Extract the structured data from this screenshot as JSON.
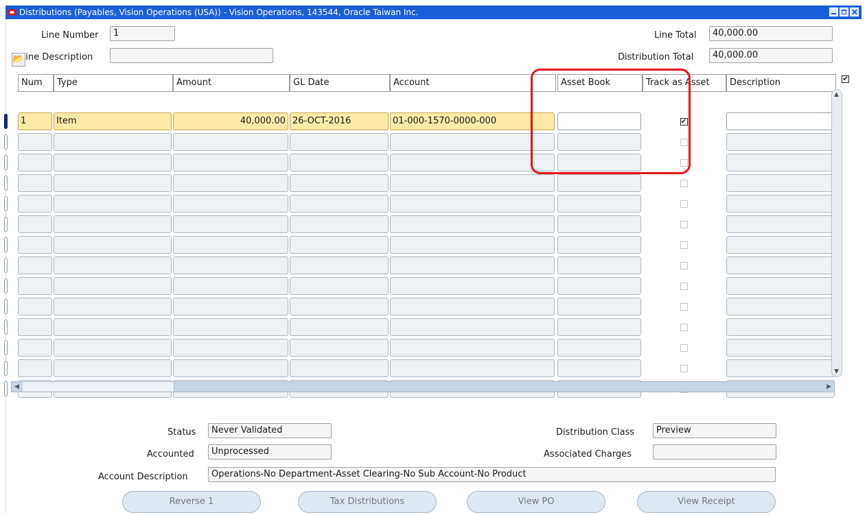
{
  "window": {
    "title": "Distributions (Payables, Vision Operations (USA)) - Vision Operations, 143544, Oracle Taiwan Inc."
  },
  "header": {
    "line_number_label": "Line Number",
    "line_number_value": "1",
    "line_description_label": "Line Description",
    "line_description_value": "",
    "line_total_label": "Line Total",
    "line_total_value": "40,000.00",
    "distribution_total_label": "Distribution Total",
    "distribution_total_value": "40,000.00",
    "select_all_checked": true
  },
  "table": {
    "columns": [
      "Num",
      "Type",
      "Amount",
      "GL Date",
      "Account",
      "Asset Book",
      "Track as Asset",
      "Description"
    ],
    "rows": [
      {
        "num": "1",
        "type": "Item",
        "amount": "40,000.00",
        "gl_date": "26-OCT-2016",
        "account": "01-000-1570-0000-000",
        "asset_book": "",
        "track_as_asset": true,
        "description": ""
      }
    ],
    "empty_rows": 13
  },
  "footer": {
    "status_label": "Status",
    "status_value": "Never Validated",
    "accounted_label": "Accounted",
    "accounted_value": "Unprocessed",
    "account_description_label": "Account Description",
    "account_description_value": "Operations-No Department-Asset Clearing-No Sub Account-No Product",
    "distribution_class_label": "Distribution Class",
    "distribution_class_value": "Preview",
    "associated_charges_label": "Associated Charges",
    "associated_charges_value": ""
  },
  "buttons": {
    "reverse": "Reverse 1",
    "tax_distributions": "Tax Distributions",
    "view_po": "View PO",
    "view_receipt": "View Receipt"
  },
  "colors": {
    "titlebar": "#1b5fd8",
    "current_row": "#fdeaa8",
    "highlight_box": "#e8121b"
  }
}
